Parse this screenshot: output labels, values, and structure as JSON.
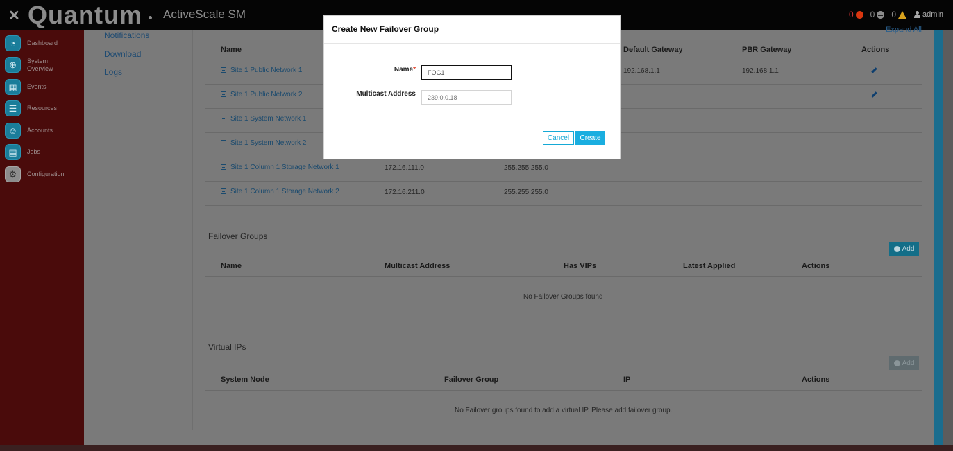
{
  "topbar": {
    "close_glyph": "✕",
    "brand": "Quantum",
    "product": "ActiveScale SM",
    "status": {
      "errors": "0",
      "disabled": "0",
      "warnings": "0",
      "user": "admin"
    }
  },
  "sidebar": {
    "items": [
      {
        "label": "Dashboard",
        "icon": "dashboard-icon"
      },
      {
        "label": "System Overview",
        "icon": "globe-icon"
      },
      {
        "label": "Events",
        "icon": "calendar-icon"
      },
      {
        "label": "Resources",
        "icon": "database-icon"
      },
      {
        "label": "Accounts",
        "icon": "users-icon"
      },
      {
        "label": "Jobs",
        "icon": "clipboard-icon"
      },
      {
        "label": "Configuration",
        "icon": "gear-icon"
      }
    ]
  },
  "subnav": {
    "links": [
      "Notifications",
      "Download",
      "Logs"
    ]
  },
  "networks": {
    "expand_all": "Expand All",
    "columns": [
      "Name",
      "Default Gateway",
      "PBR Gateway",
      "Actions"
    ],
    "rows": [
      {
        "name": "Site 1 Public Network 1",
        "subnet": "",
        "mask": "",
        "gateway": "192.168.1.1",
        "pbr": "192.168.1.1",
        "editable": true
      },
      {
        "name": "Site 1 Public Network 2",
        "subnet": "",
        "mask": "",
        "gateway": "",
        "pbr": "",
        "editable": true
      },
      {
        "name": "Site 1 System Network 1",
        "subnet": "",
        "mask": "",
        "gateway": "",
        "pbr": "",
        "editable": false
      },
      {
        "name": "Site 1 System Network 2",
        "subnet": "",
        "mask": "",
        "gateway": "",
        "pbr": "",
        "editable": false
      },
      {
        "name": "Site 1 Column 1 Storage Network 1",
        "subnet": "172.16.111.0",
        "mask": "255.255.255.0",
        "gateway": "",
        "pbr": "",
        "editable": false
      },
      {
        "name": "Site 1 Column 1 Storage Network 2",
        "subnet": "172.16.211.0",
        "mask": "255.255.255.0",
        "gateway": "",
        "pbr": "",
        "editable": false
      }
    ]
  },
  "failover_groups": {
    "title": "Failover Groups",
    "add_label": "Add",
    "columns": [
      "Name",
      "Multicast Address",
      "Has VIPs",
      "Latest Applied",
      "Actions"
    ],
    "empty": "No Failover Groups found"
  },
  "virtual_ips": {
    "title": "Virtual IPs",
    "add_label": "Add",
    "columns": [
      "System Node",
      "Failover Group",
      "IP",
      "Actions"
    ],
    "empty": "No Failover groups found to add a virtual IP. Please add failover group."
  },
  "modal": {
    "title": "Create New Failover Group",
    "name_label": "Name",
    "required_mark": "*",
    "name_value": "FOG1",
    "multicast_label": "Multicast Address",
    "multicast_placeholder": "239.0.0.18",
    "cancel_label": "Cancel",
    "create_label": "Create"
  },
  "colors": {
    "accent": "#1aaee0",
    "sidebar_bg": "#4a0b0b",
    "required": "#e0432d"
  }
}
